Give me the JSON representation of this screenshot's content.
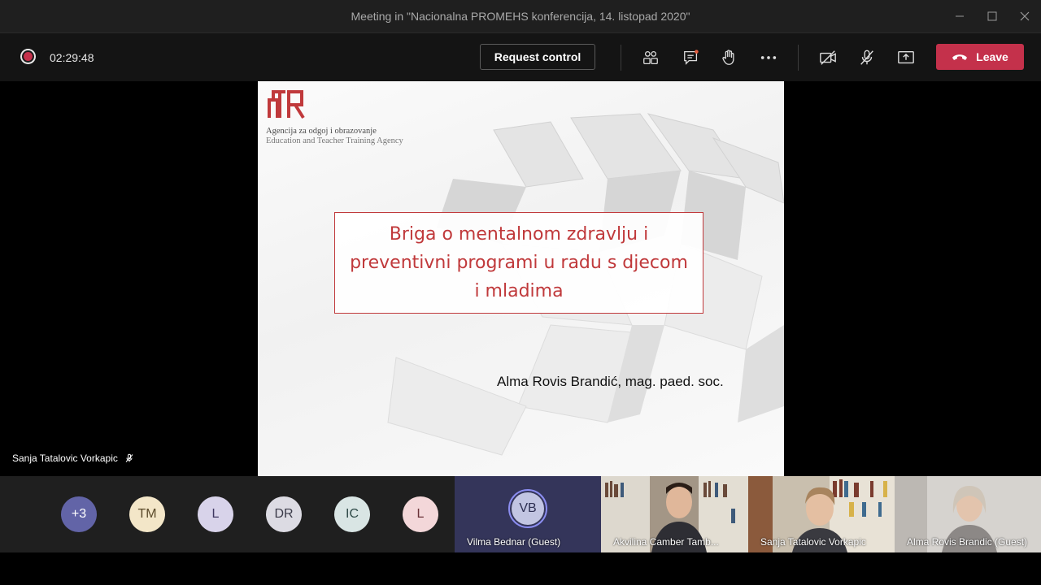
{
  "window": {
    "title": "Meeting in \"Nacionalna PROMEHS konferencija, 14. listopad 2020\"",
    "controls": [
      "minimize-icon",
      "maximize-icon",
      "close-icon"
    ]
  },
  "toolbar": {
    "recording_icon": "record-dot-icon",
    "timer": "02:29:48",
    "request_control_label": "Request control",
    "icons": [
      "participants-icon",
      "chat-icon",
      "raise-hand-icon",
      "more-icon",
      "camera-off-icon",
      "mic-off-icon",
      "share-screen-icon"
    ],
    "leave_label": "Leave",
    "leave_color": "#c4314b"
  },
  "slide": {
    "agency_line1": "Agencija za odgoj i obrazovanje",
    "agency_line2": "Education and Teacher Training Agency",
    "title": "Briga o mentalnom zdravlju i preventivni programi u radu s djecom i mladima",
    "author": "Alma Rovis Brandić, mag. paed. soc.",
    "accent_color": "#c0393b"
  },
  "presenter": {
    "name": "Sanja Tatalovic Vorkapic",
    "mic_icon": "mic-off-icon"
  },
  "participants": {
    "overflow_label": "+3",
    "avatars": [
      {
        "initials": "TM",
        "bg": "#f3e6c8",
        "fg": "#5a4a2a"
      },
      {
        "initials": "L",
        "bg": "#d8d3ea",
        "fg": "#3e3760"
      },
      {
        "initials": "DR",
        "bg": "#dcdbe3",
        "fg": "#3a3a48"
      },
      {
        "initials": "IC",
        "bg": "#d9e5e4",
        "fg": "#2f4a48"
      },
      {
        "initials": "L",
        "bg": "#f3d7d9",
        "fg": "#6a3338"
      }
    ],
    "active_tile": {
      "initials": "VB",
      "name": "Vilma Bednar (Guest)"
    },
    "video_tiles": [
      {
        "name": "Akvilina Camber Tamb..."
      },
      {
        "name": "Sanja Tatalovic Vorkapic"
      },
      {
        "name": "Alma Rovis Brandic (Guest)"
      }
    ]
  }
}
